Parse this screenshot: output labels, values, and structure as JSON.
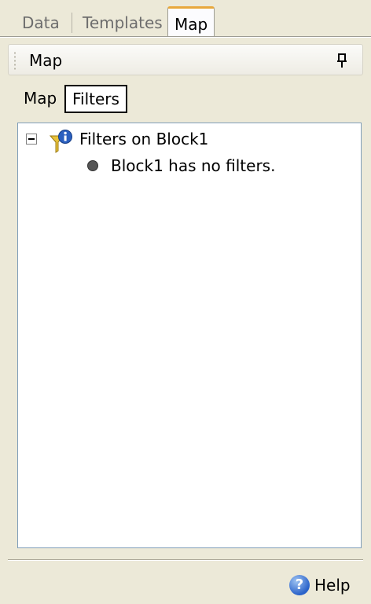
{
  "tabs": [
    {
      "label": "Data",
      "active": false
    },
    {
      "label": "Templates",
      "active": false
    },
    {
      "label": "Map",
      "active": true
    }
  ],
  "pane": {
    "title": "Map",
    "pin_icon": "pin-icon"
  },
  "subtabs": [
    {
      "label": "Map",
      "active": false
    },
    {
      "label": "Filters",
      "active": true
    }
  ],
  "tree": {
    "root": {
      "label": "Filters on Block1",
      "icon": "filter-info-icon",
      "expanded": true
    },
    "children": [
      {
        "label": "Block1 has no filters.",
        "icon": "bullet-icon"
      }
    ]
  },
  "footer": {
    "help_label": "Help",
    "help_icon": "help-icon"
  },
  "colors": {
    "background": "#ece9d8",
    "active_tab_accent": "#e8a83b",
    "tree_border": "#7f9db9",
    "help_blue": "#2a62c9"
  }
}
